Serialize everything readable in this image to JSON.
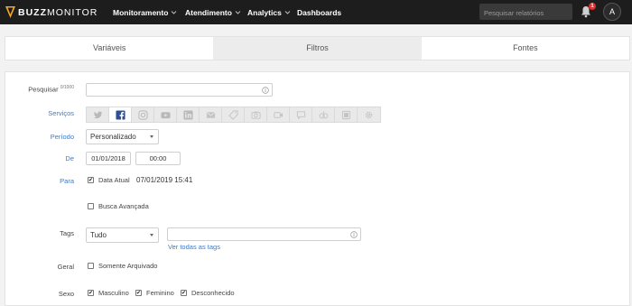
{
  "header": {
    "logo": {
      "prefix": "BUZZ",
      "suffix": "MONITOR"
    },
    "nav": [
      {
        "label": "Monitoramento",
        "has_dropdown": true
      },
      {
        "label": "Atendimento",
        "has_dropdown": true
      },
      {
        "label": "Analytics",
        "has_dropdown": true
      },
      {
        "label": "Dashboards",
        "has_dropdown": false
      }
    ],
    "search_placeholder": "Pesquisar relatórios",
    "notification_count": "1",
    "avatar_initial": "A"
  },
  "tabs": [
    {
      "label": "Variáveis",
      "active": false
    },
    {
      "label": "Filtros",
      "active": true
    },
    {
      "label": "Fontes",
      "active": false
    }
  ],
  "form": {
    "pesquisar": {
      "label": "Pesquisar",
      "counter": "0/1000",
      "value": ""
    },
    "servicos": {
      "label": "Serviços",
      "icons": [
        "twitter-icon",
        "facebook-icon",
        "instagram-icon",
        "youtube-icon",
        "linkedin-icon",
        "email-icon",
        "tag-icon",
        "camera-icon",
        "video-icon",
        "chat-icon",
        "reclame-aqui-icon",
        "news-icon",
        "gear-icon"
      ],
      "active_index": 1
    },
    "periodo": {
      "label": "Período",
      "value": "Personalizado"
    },
    "de": {
      "label": "De",
      "date": "01/01/2018",
      "time": "00:00"
    },
    "para": {
      "label": "Para",
      "checkbox_label": "Data Atual",
      "checked": true,
      "value": "07/01/2019 15:41"
    },
    "busca_avancada": {
      "label": "Busca Avançada",
      "checked": false
    },
    "tags": {
      "label": "Tags",
      "select_value": "Tudo",
      "input_value": "",
      "link": "Ver todas as tags"
    },
    "geral": {
      "label": "Geral",
      "checkbox_label": "Somente Arquivado",
      "checked": false
    },
    "sexo": {
      "label": "Sexo",
      "options": [
        {
          "label": "Masculino",
          "checked": true
        },
        {
          "label": "Feminino",
          "checked": true
        },
        {
          "label": "Desconhecido",
          "checked": true
        }
      ]
    }
  },
  "colors": {
    "topbar": "#1d1d1d",
    "accent_blue": "#3d7ac7",
    "logo_orange": "#f5a623",
    "badge_red": "#e03030"
  }
}
